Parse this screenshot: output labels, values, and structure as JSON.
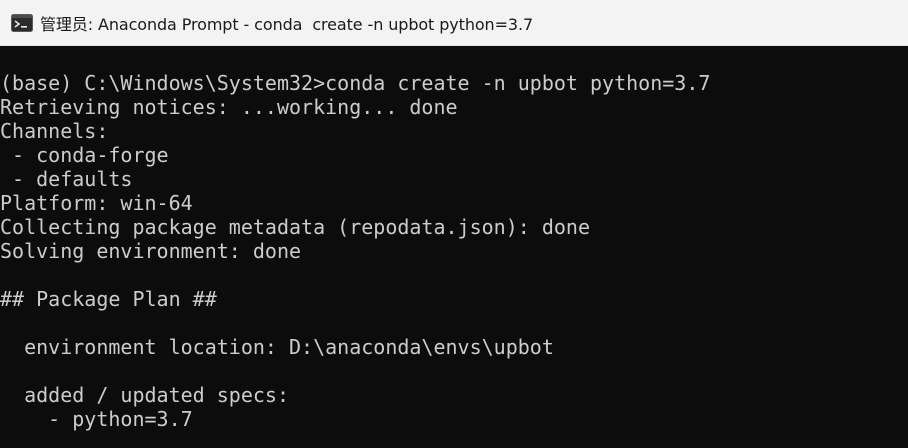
{
  "window": {
    "title": "管理员: Anaconda Prompt - conda  create -n upbot python=3.7",
    "icon": "terminal-icon"
  },
  "terminal": {
    "lines": [
      "",
      "(base) C:\\Windows\\System32>conda create -n upbot python=3.7",
      "Retrieving notices: ...working... done",
      "Channels:",
      " - conda-forge",
      " - defaults",
      "Platform: win-64",
      "Collecting package metadata (repodata.json): done",
      "Solving environment: done",
      "",
      "## Package Plan ##",
      "",
      "  environment location: D:\\anaconda\\envs\\upbot",
      "",
      "  added / updated specs:",
      "    - python=3.7"
    ]
  },
  "colors": {
    "terminal_bg": "#0c0c0c",
    "terminal_fg": "#cccccc",
    "titlebar_bg": "#f3f3f3"
  }
}
